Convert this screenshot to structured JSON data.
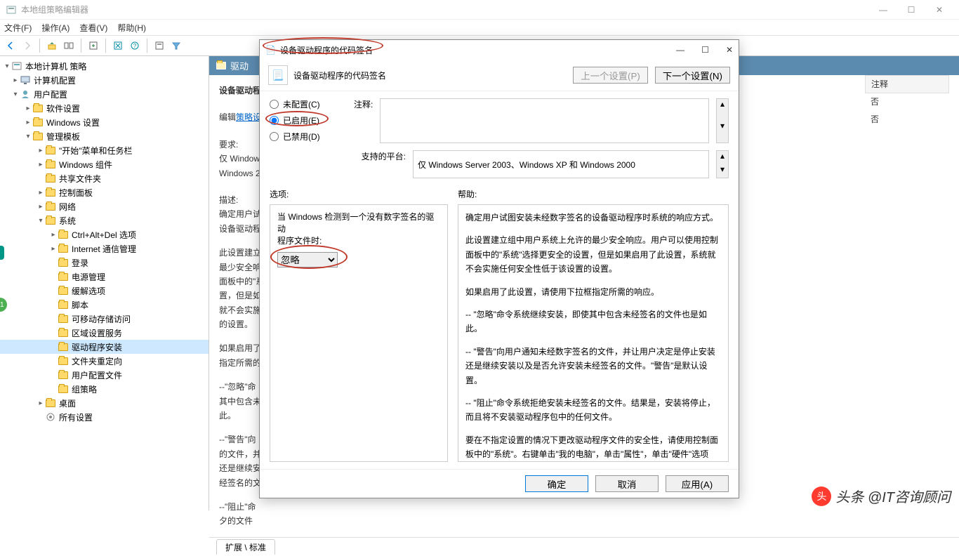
{
  "window": {
    "title": "本地组策略编辑器"
  },
  "menu": {
    "file": "文件(F)",
    "action": "操作(A)",
    "view": "查看(V)",
    "help": "帮助(H)"
  },
  "tree": {
    "root": "本地计算机 策略",
    "computer": "计算机配置",
    "user": "用户配置",
    "soft": "软件设置",
    "winset": "Windows 设置",
    "admin": "管理模板",
    "startmenu": "\"开始\"菜单和任务栏",
    "wincomp": "Windows 组件",
    "share": "共享文件夹",
    "control": "控制面板",
    "network": "网络",
    "system": "系统",
    "cad": "Ctrl+Alt+Del 选项",
    "ie": "Internet 通信管理",
    "login": "登录",
    "power": "电源管理",
    "mitigate": "缓解选项",
    "script": "脚本",
    "removable": "可移动存储访问",
    "locale": "区域设置服务",
    "driver": "驱动程序安装",
    "redirect": "文件夹重定向",
    "userprof": "用户配置文件",
    "gpolicy": "组策略",
    "desktop": "桌面",
    "allset": "所有设置"
  },
  "content": {
    "header": "驱动",
    "title": "设备驱动程",
    "edit_prefix": "编辑",
    "edit_link": "策略设",
    "req_label": "要求:",
    "req_text": "仅 Window",
    "req_text2": "Windows 2",
    "desc_label": "描述:",
    "desc_l1": "确定用户试",
    "desc_l2": "设备驱动程",
    "p1_l1": "此设置建立",
    "p1_l2": "最少安全响",
    "p1_l3": "面板中的\"系",
    "p1_l4": "置，但是如",
    "p1_l5": "就不会实施",
    "p1_l6": "的设置。",
    "p2_l1": "如果启用了",
    "p2_l2": "指定所需的",
    "p3_l1": "--\"忽略\"命",
    "p3_l2": "其中包含未",
    "p3_l3": "此。",
    "p4_l1": "--\"警告\"向",
    "p4_l2": "的文件，并",
    "p4_l3": "还是继续安",
    "p4_l4": "经签名的文",
    "p5_l1": "--\"阻止\"命",
    "p5_l2": "夕的文件",
    "tabs": "扩展 \\ 标准",
    "col_comment": "注释",
    "col_no1": "否",
    "col_no2": "否"
  },
  "dialog": {
    "title": "设备驱动程序的代码签名",
    "header": "设备驱动程序的代码签名",
    "prev": "上一个设置(P)",
    "next": "下一个设置(N)",
    "r_notconf": "未配置(C)",
    "r_enabled": "已启用(E)",
    "r_disabled": "已禁用(D)",
    "comment_label": "注释:",
    "platform_label": "支持的平台:",
    "platform_text": "仅 Windows Server 2003、Windows XP 和 Windows 2000",
    "options_label": "选项:",
    "help_label": "帮助:",
    "option_line1": "当 Windows 检测到一个没有数字签名的驱动",
    "option_line2": "程序文件时:",
    "option_select": "忽略",
    "help_p1": "确定用户试图安装未经数字签名的设备驱动程序时系统的响应方式。",
    "help_p2": "此设置建立组中用户系统上允许的最少安全响应。用户可以使用控制面板中的\"系统\"选择更安全的设置，但是如果启用了此设置，系统就不会实施任何安全性低于该设置的设置。",
    "help_p3": "如果启用了此设置，请使用下拉框指定所需的响应。",
    "help_p4": "-- \"忽略\"命令系统继续安装，即使其中包含未经签名的文件也是如此。",
    "help_p5": "-- \"警告\"向用户通知未经数字签名的文件，并让用户决定是停止安装还是继续安装以及是否允许安装未经签名的文件。\"警告\"是默认设置。",
    "help_p6": "-- \"阻止\"命令系统拒绝安装未经签名的文件。结果是，安装将停止，而且将不安装驱动程序包中的任何文件。",
    "help_p7": "要在不指定设置的情况下更改驱动程序文件的安全性，请使用控制面板中的\"系统\"。右键单击\"我的电脑\"，单击\"属性\"，单击\"硬件\"选项卡，然后单击\"驱动程序签名\"按钮。",
    "ok": "确定",
    "cancel": "取消",
    "apply": "应用(A)"
  },
  "watermark": "头条 @IT咨询顾问"
}
